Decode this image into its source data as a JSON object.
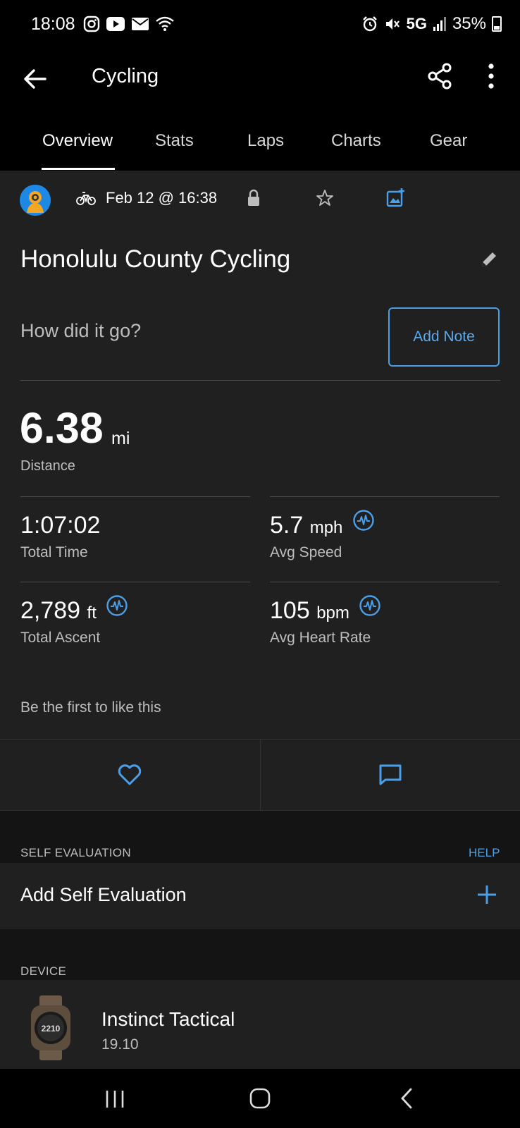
{
  "status_bar": {
    "time": "18:08",
    "network": "5G",
    "battery": "35%",
    "left_icons": [
      "instagram-icon",
      "youtube-icon",
      "mail-icon",
      "wifi-icon"
    ],
    "right_icons": [
      "alarm-icon",
      "mute-icon",
      "signal-icon",
      "battery-icon"
    ]
  },
  "app_bar": {
    "title": "Cycling",
    "back_icon": "arrow-left-icon",
    "share_icon": "share-icon",
    "more_icon": "more-vertical-icon"
  },
  "tabs": [
    {
      "label": "Overview",
      "active": true
    },
    {
      "label": "Stats",
      "active": false
    },
    {
      "label": "Laps",
      "active": false
    },
    {
      "label": "Charts",
      "active": false
    },
    {
      "label": "Gear",
      "active": false
    }
  ],
  "activity": {
    "date": "Feb 12 @ 16:38",
    "title": "Honolulu County Cycling",
    "note_prompt": "How did it go?",
    "add_note_label": "Add Note",
    "distance": {
      "value": "6.38",
      "unit": "mi",
      "label": "Distance"
    },
    "stats": [
      {
        "value": "1:07:02",
        "unit": "",
        "label": "Total Time",
        "has_chart_icon": false
      },
      {
        "value": "5.7",
        "unit": "mph",
        "label": "Avg Speed",
        "has_chart_icon": true
      },
      {
        "value": "2,789",
        "unit": "ft",
        "label": "Total Ascent",
        "has_chart_icon": true
      },
      {
        "value": "105",
        "unit": "bpm",
        "label": "Avg Heart Rate",
        "has_chart_icon": true
      }
    ],
    "likes_text": "Be the first to like this"
  },
  "self_evaluation": {
    "header": "SELF EVALUATION",
    "help_label": "HELP",
    "add_label": "Add Self Evaluation"
  },
  "device": {
    "header": "DEVICE",
    "name": "Instinct Tactical",
    "version": "19.10",
    "watch_display": "2210"
  },
  "colors": {
    "accent": "#4a9fe8",
    "background": "#202020",
    "section_gap": "#141414",
    "header_bg": "#000000"
  }
}
